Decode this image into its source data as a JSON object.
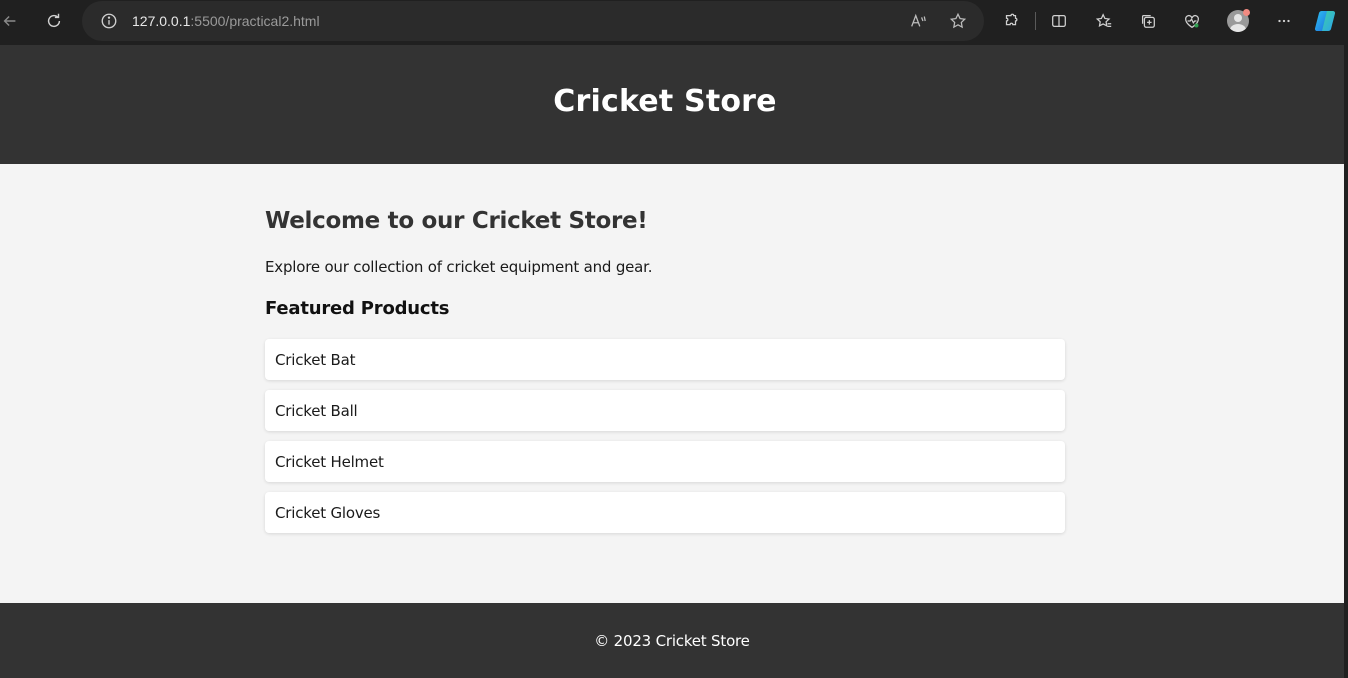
{
  "browser": {
    "url_host": "127.0.0.1",
    "url_rest": ":5500/practical2.html",
    "icons": [
      "back-icon",
      "refresh-icon",
      "site-info-icon",
      "read-aloud-icon",
      "favorite-star-icon",
      "extensions-icon",
      "split-screen-icon",
      "favorites-icon",
      "collections-icon",
      "browser-essentials-icon",
      "profile-avatar",
      "more-options-icon",
      "copilot-icon"
    ],
    "colors": {
      "chrome": "#202020",
      "address_bar": "#2b2b2b",
      "badge": "#f28b82"
    }
  },
  "header": {
    "title": "Cricket Store"
  },
  "main": {
    "welcome": "Welcome to our Cricket Store!",
    "intro": "Explore our collection of cricket equipment and gear.",
    "featured_title": "Featured Products",
    "products": [
      "Cricket Bat",
      "Cricket Ball",
      "Cricket Helmet",
      "Cricket Gloves"
    ]
  },
  "footer": {
    "text": "© 2023 Cricket Store"
  },
  "colors": {
    "header_bg": "#333333",
    "page_bg": "#f4f4f4",
    "card_bg": "#ffffff",
    "heading": "#333333"
  }
}
